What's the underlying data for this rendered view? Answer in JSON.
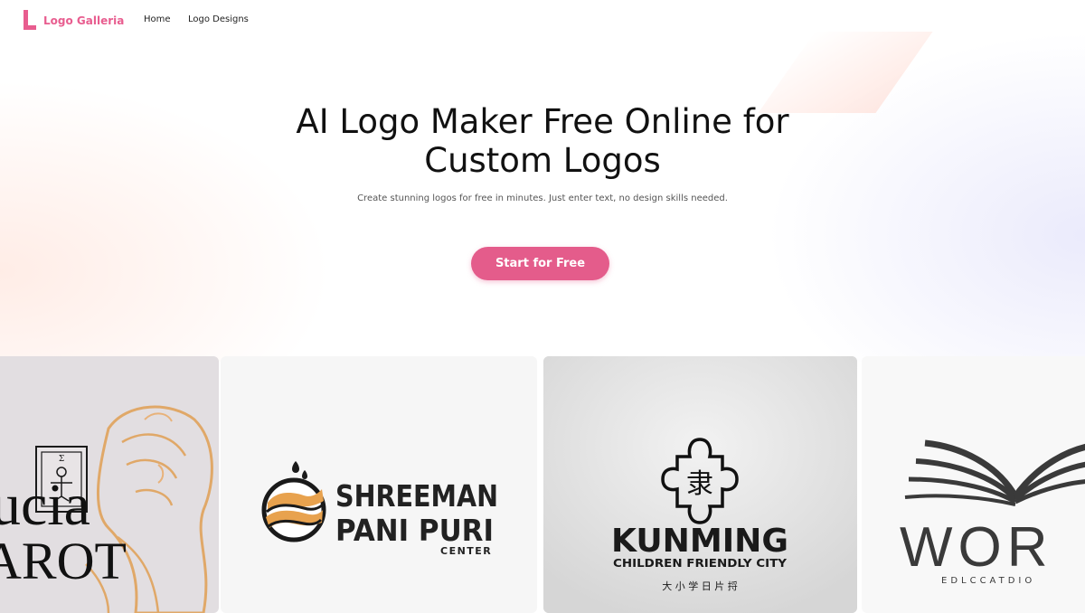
{
  "header": {
    "brand_name": "Logo Galleria",
    "nav": [
      "Home",
      "Logo Designs"
    ]
  },
  "hero": {
    "title_line1": "AI Logo Maker Free Online for",
    "title_line2": "Custom Logos",
    "subtitle": "Create stunning logos for free in minutes. Just enter text, no design skills needed.",
    "cta_label": "Start for Free"
  },
  "gallery": [
    {
      "line1": "ucia",
      "line2": "AROT",
      "seal": "Σ"
    },
    {
      "line1": "SHREEMAN",
      "line2": "PANI PURI",
      "line3": "CENTER"
    },
    {
      "line1": "KUNMING",
      "line2": "CHILDREN FRIENDLY CITY",
      "line3": "大 小 学 日 片 捋",
      "glyph": "隶"
    },
    {
      "line1": "WOR",
      "line2": "EDLCCATDIO"
    }
  ],
  "colors": {
    "accent": "#e45c8b",
    "brand": "#e85d8f"
  }
}
